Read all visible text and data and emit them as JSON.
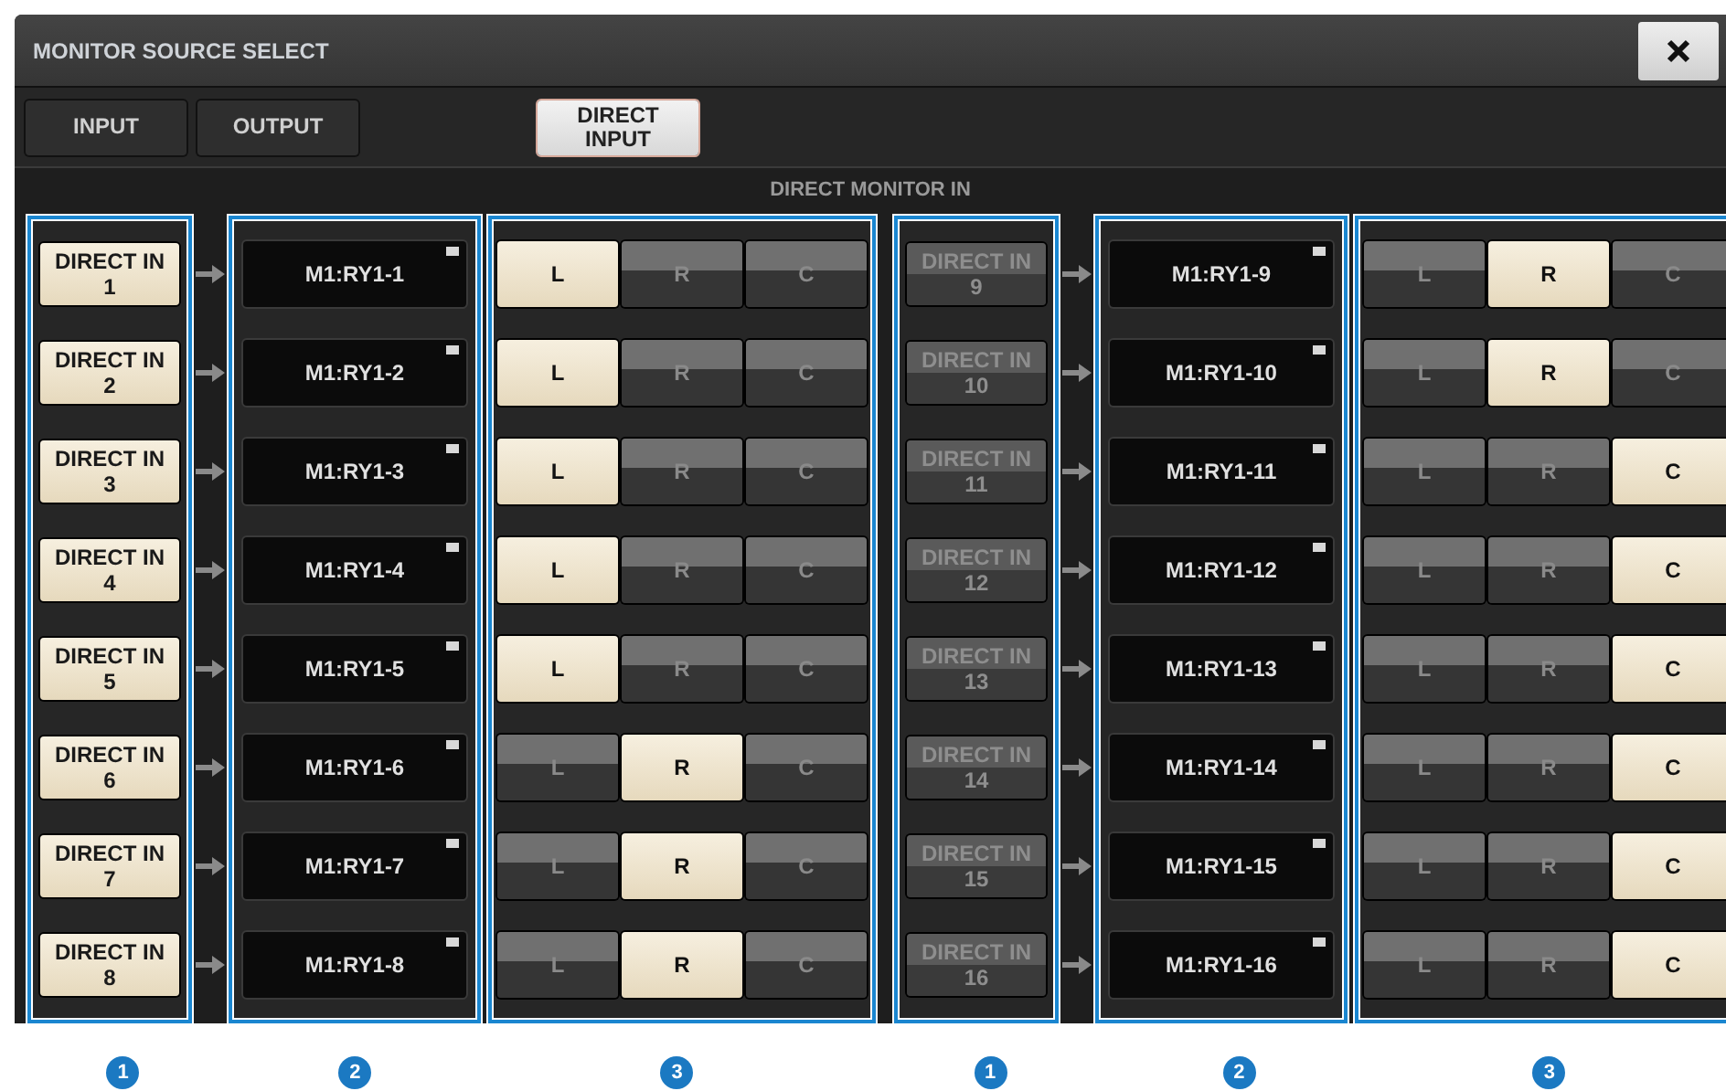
{
  "window": {
    "title": "MONITOR SOURCE SELECT"
  },
  "tabs": [
    {
      "label": "INPUT",
      "selected": false
    },
    {
      "label": "OUTPUT",
      "selected": false
    },
    {
      "label": "DIRECT INPUT",
      "selected": true
    }
  ],
  "section_title": "DIRECT MONITOR IN",
  "banks": [
    {
      "channels": [
        {
          "source": "DIRECT IN",
          "number": "1",
          "on": true,
          "port": "M1:RY1-1",
          "outputs": [
            {
              "label": "L",
              "selected": true
            },
            {
              "label": "R",
              "selected": false
            },
            {
              "label": "C",
              "selected": false
            }
          ]
        },
        {
          "source": "DIRECT IN",
          "number": "2",
          "on": true,
          "port": "M1:RY1-2",
          "outputs": [
            {
              "label": "L",
              "selected": true
            },
            {
              "label": "R",
              "selected": false
            },
            {
              "label": "C",
              "selected": false
            }
          ]
        },
        {
          "source": "DIRECT IN",
          "number": "3",
          "on": true,
          "port": "M1:RY1-3",
          "outputs": [
            {
              "label": "L",
              "selected": true
            },
            {
              "label": "R",
              "selected": false
            },
            {
              "label": "C",
              "selected": false
            }
          ]
        },
        {
          "source": "DIRECT IN",
          "number": "4",
          "on": true,
          "port": "M1:RY1-4",
          "outputs": [
            {
              "label": "L",
              "selected": true
            },
            {
              "label": "R",
              "selected": false
            },
            {
              "label": "C",
              "selected": false
            }
          ]
        },
        {
          "source": "DIRECT IN",
          "number": "5",
          "on": true,
          "port": "M1:RY1-5",
          "outputs": [
            {
              "label": "L",
              "selected": true
            },
            {
              "label": "R",
              "selected": false
            },
            {
              "label": "C",
              "selected": false
            }
          ]
        },
        {
          "source": "DIRECT IN",
          "number": "6",
          "on": true,
          "port": "M1:RY1-6",
          "outputs": [
            {
              "label": "L",
              "selected": false
            },
            {
              "label": "R",
              "selected": true
            },
            {
              "label": "C",
              "selected": false
            }
          ]
        },
        {
          "source": "DIRECT IN",
          "number": "7",
          "on": true,
          "port": "M1:RY1-7",
          "outputs": [
            {
              "label": "L",
              "selected": false
            },
            {
              "label": "R",
              "selected": true
            },
            {
              "label": "C",
              "selected": false
            }
          ]
        },
        {
          "source": "DIRECT IN",
          "number": "8",
          "on": true,
          "port": "M1:RY1-8",
          "outputs": [
            {
              "label": "L",
              "selected": false
            },
            {
              "label": "R",
              "selected": true
            },
            {
              "label": "C",
              "selected": false
            }
          ]
        }
      ]
    },
    {
      "channels": [
        {
          "source": "DIRECT IN",
          "number": "9",
          "on": false,
          "port": "M1:RY1-9",
          "outputs": [
            {
              "label": "L",
              "selected": false
            },
            {
              "label": "R",
              "selected": true
            },
            {
              "label": "C",
              "selected": false
            }
          ]
        },
        {
          "source": "DIRECT IN",
          "number": "10",
          "on": false,
          "port": "M1:RY1-10",
          "outputs": [
            {
              "label": "L",
              "selected": false
            },
            {
              "label": "R",
              "selected": true
            },
            {
              "label": "C",
              "selected": false
            }
          ]
        },
        {
          "source": "DIRECT IN",
          "number": "11",
          "on": false,
          "port": "M1:RY1-11",
          "outputs": [
            {
              "label": "L",
              "selected": false
            },
            {
              "label": "R",
              "selected": false
            },
            {
              "label": "C",
              "selected": true
            }
          ]
        },
        {
          "source": "DIRECT IN",
          "number": "12",
          "on": false,
          "port": "M1:RY1-12",
          "outputs": [
            {
              "label": "L",
              "selected": false
            },
            {
              "label": "R",
              "selected": false
            },
            {
              "label": "C",
              "selected": true
            }
          ]
        },
        {
          "source": "DIRECT IN",
          "number": "13",
          "on": false,
          "port": "M1:RY1-13",
          "outputs": [
            {
              "label": "L",
              "selected": false
            },
            {
              "label": "R",
              "selected": false
            },
            {
              "label": "C",
              "selected": true
            }
          ]
        },
        {
          "source": "DIRECT IN",
          "number": "14",
          "on": false,
          "port": "M1:RY1-14",
          "outputs": [
            {
              "label": "L",
              "selected": false
            },
            {
              "label": "R",
              "selected": false
            },
            {
              "label": "C",
              "selected": true
            }
          ]
        },
        {
          "source": "DIRECT IN",
          "number": "15",
          "on": false,
          "port": "M1:RY1-15",
          "outputs": [
            {
              "label": "L",
              "selected": false
            },
            {
              "label": "R",
              "selected": false
            },
            {
              "label": "C",
              "selected": true
            }
          ]
        },
        {
          "source": "DIRECT IN",
          "number": "16",
          "on": false,
          "port": "M1:RY1-16",
          "outputs": [
            {
              "label": "L",
              "selected": false
            },
            {
              "label": "R",
              "selected": false
            },
            {
              "label": "C",
              "selected": true
            }
          ]
        }
      ]
    }
  ],
  "callouts": [
    "1",
    "2",
    "3",
    "1",
    "2",
    "3"
  ]
}
